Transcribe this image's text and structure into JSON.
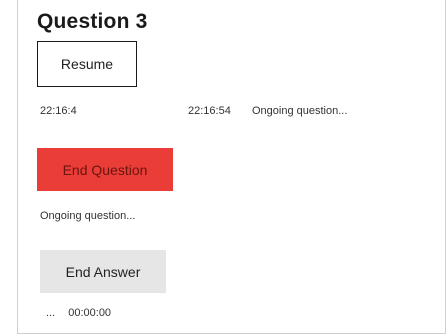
{
  "title": "Question 3",
  "buttons": {
    "resume": "Resume",
    "end_question": "End Question",
    "end_answer": "End Answer"
  },
  "times": {
    "start": "22:16:4",
    "current": "22:16:54",
    "inline_status": "Ongoing question..."
  },
  "status": "Ongoing question...",
  "answer_timer": {
    "prefix": "...",
    "time": "00:00:00"
  },
  "colors": {
    "end_question_bg": "#ea3d37",
    "end_answer_bg": "#e6e6e6"
  }
}
